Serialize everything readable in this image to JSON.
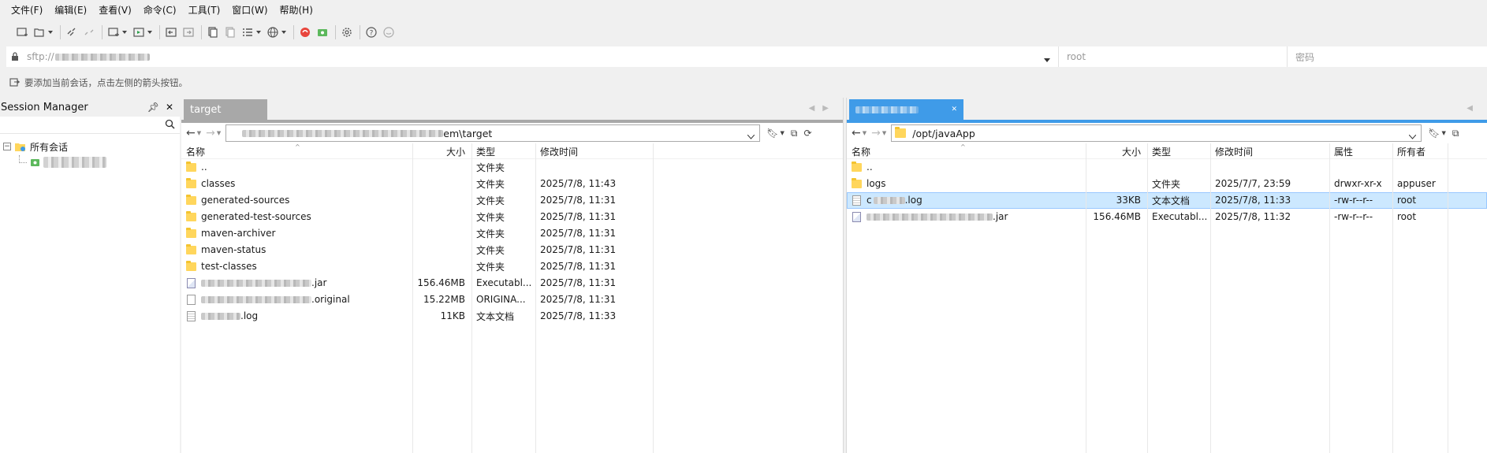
{
  "menu": [
    {
      "label": "文件(F)"
    },
    {
      "label": "编辑(E)"
    },
    {
      "label": "查看(V)"
    },
    {
      "label": "命令(C)"
    },
    {
      "label": "工具(T)"
    },
    {
      "label": "窗口(W)"
    },
    {
      "label": "帮助(H)"
    }
  ],
  "address": {
    "host_prefix": "sftp://",
    "user_placeholder": "root",
    "password_placeholder": "密码"
  },
  "hint": "要添加当前会话，点击左侧的箭头按钮。",
  "session": {
    "title": "Session Manager",
    "pin_icon": "pin-icon",
    "close_icon": "close-icon",
    "root_label": "所有会话"
  },
  "left_pane": {
    "tab_label": "target",
    "path_suffix": "em\\target",
    "columns": [
      "名称",
      "大小",
      "类型",
      "修改时间"
    ],
    "rows": [
      {
        "name": "..",
        "size": "",
        "type": "文件夹",
        "mtime": "",
        "icon": "folder"
      },
      {
        "name": "classes",
        "size": "",
        "type": "文件夹",
        "mtime": "2025/7/8, 11:43",
        "icon": "folder"
      },
      {
        "name": "generated-sources",
        "size": "",
        "type": "文件夹",
        "mtime": "2025/7/8, 11:31",
        "icon": "folder"
      },
      {
        "name": "generated-test-sources",
        "size": "",
        "type": "文件夹",
        "mtime": "2025/7/8, 11:31",
        "icon": "folder"
      },
      {
        "name": "maven-archiver",
        "size": "",
        "type": "文件夹",
        "mtime": "2025/7/8, 11:31",
        "icon": "folder"
      },
      {
        "name": "maven-status",
        "size": "",
        "type": "文件夹",
        "mtime": "2025/7/8, 11:31",
        "icon": "folder"
      },
      {
        "name": "test-classes",
        "size": "",
        "type": "文件夹",
        "mtime": "2025/7/8, 11:31",
        "icon": "folder"
      },
      {
        "name": ".jar",
        "size": "156.46MB",
        "type": "Executabl...",
        "mtime": "2025/7/8, 11:31",
        "icon": "jar"
      },
      {
        "name": ".original",
        "size": "15.22MB",
        "type": "ORIGINA...",
        "mtime": "2025/7/8, 11:31",
        "icon": "file"
      },
      {
        "name": ".log",
        "size": "11KB",
        "type": "文本文档",
        "mtime": "2025/7/8, 11:33",
        "icon": "log"
      }
    ]
  },
  "right_pane": {
    "path": "/opt/javaApp",
    "columns": [
      "名称",
      "大小",
      "类型",
      "修改时间",
      "属性",
      "所有者"
    ],
    "rows": [
      {
        "name": "..",
        "size": "",
        "type": "",
        "mtime": "",
        "attr": "",
        "owner": "",
        "icon": "folder"
      },
      {
        "name": "logs",
        "size": "",
        "type": "文件夹",
        "mtime": "2025/7/7, 23:59",
        "attr": "drwxr-xr-x",
        "owner": "appuser",
        "icon": "folder"
      },
      {
        "name": ".log",
        "name_prefix": "c",
        "size": "33KB",
        "type": "文本文档",
        "mtime": "2025/7/8, 11:33",
        "attr": "-rw-r--r--",
        "owner": "root",
        "icon": "log",
        "selected": true
      },
      {
        "name": ".jar",
        "size": "156.46MB",
        "type": "Executabl...",
        "mtime": "2025/7/8, 11:32",
        "attr": "-rw-r--r--",
        "owner": "root",
        "icon": "jar"
      }
    ]
  }
}
